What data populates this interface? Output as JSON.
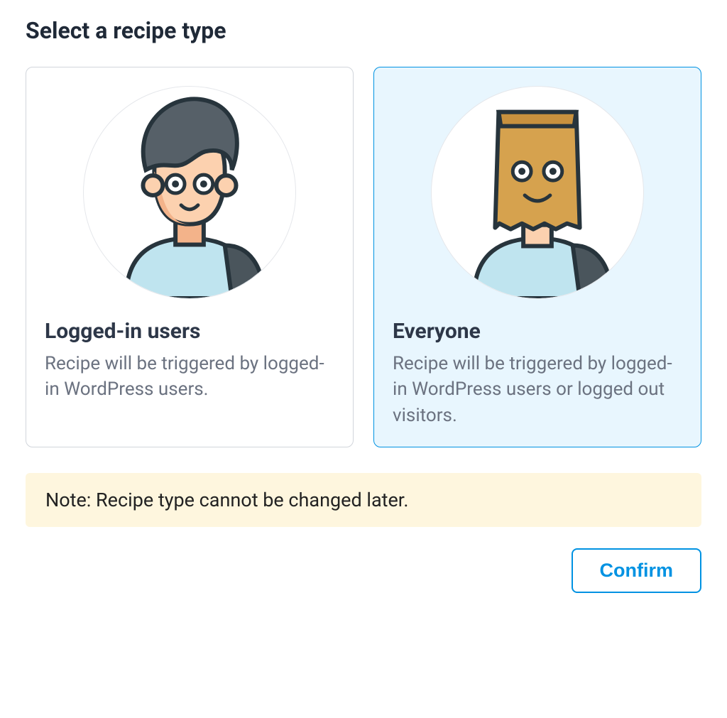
{
  "title": "Select a recipe type",
  "cards": [
    {
      "title": "Logged-in users",
      "description": "Recipe will be triggered by logged-in WordPress users.",
      "selected": false
    },
    {
      "title": "Everyone",
      "description": "Recipe will be triggered by logged-in WordPress users or logged out visitors.",
      "selected": true
    }
  ],
  "note": "Note: Recipe type cannot be changed later.",
  "confirm_label": "Confirm"
}
